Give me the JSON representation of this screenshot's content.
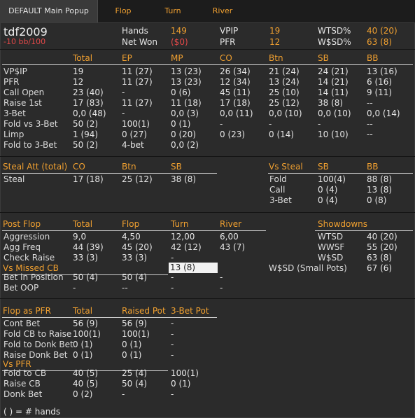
{
  "tabs": [
    "DEFAULT Main Popup",
    "Flop",
    "Turn",
    "River"
  ],
  "header": {
    "player": "tdf2009",
    "bb100": "-10 bb/100",
    "hands_label": "Hands",
    "hands": "149",
    "netwon_label": "Net Won",
    "netwon": "($0)",
    "vpip_label": "VPIP",
    "vpip": "19",
    "pfr_label": "PFR",
    "pfr": "12",
    "wtsd_label": "WTSD%",
    "wtsd": "40 (20)",
    "wsd_label": "W$SD%",
    "wsd": "63 (8)"
  },
  "preflop": {
    "columns": [
      "Total",
      "EP",
      "MP",
      "CO",
      "Btn",
      "SB",
      "BB"
    ],
    "rows": [
      {
        "label": "VP$IP",
        "cells": [
          "19",
          "11 (27)",
          "13 (23)",
          "26 (34)",
          "21 (24)",
          "24 (21)",
          "13 (16)"
        ]
      },
      {
        "label": "PFR",
        "cells": [
          "12",
          "11 (27)",
          "13 (23)",
          "12 (34)",
          "13 (24)",
          "14 (21)",
          "6 (16)"
        ]
      },
      {
        "label": "Call Open",
        "cells": [
          "23 (40)",
          "-",
          "0 (6)",
          "45 (11)",
          "25 (10)",
          "14 (11)",
          "9 (11)"
        ]
      },
      {
        "label": "Raise 1st",
        "cells": [
          "17 (83)",
          "11 (27)",
          "11 (18)",
          "17 (18)",
          "25 (12)",
          "38 (8)",
          "--"
        ]
      },
      {
        "label": "3-Bet",
        "cells": [
          "0,0 (48)",
          "-",
          "0,0 (3)",
          "0,0 (11)",
          "0,0 (10)",
          "0,0 (10)",
          "0,0 (14)"
        ]
      },
      {
        "label": "Fold vs 3-Bet",
        "cells": [
          "50 (2)",
          "100(1)",
          "0 (1)",
          "-",
          "-",
          "-",
          "--"
        ]
      },
      {
        "label": "Limp",
        "cells": [
          "1 (94)",
          "0 (27)",
          "0 (20)",
          "0 (23)",
          "0 (14)",
          "10 (10)",
          "--"
        ]
      },
      {
        "label": "Fold to 3-Bet",
        "cells": [
          "50 (2)",
          "4-bet",
          "0,0 (2)",
          "",
          "",
          "",
          ""
        ]
      }
    ]
  },
  "steal": {
    "title": "Steal Att (total)",
    "columns": [
      "CO",
      "Btn",
      "SB"
    ],
    "row": {
      "label": "Steal",
      "cells": [
        "17 (18)",
        "25 (12)",
        "38 (8)"
      ]
    },
    "vs_title": "Vs Steal",
    "vs_columns": [
      "SB",
      "BB"
    ],
    "vs_rows": [
      {
        "label": "Fold",
        "cells": [
          "100(4)",
          "88 (8)"
        ]
      },
      {
        "label": "Call",
        "cells": [
          "0 (4)",
          "13 (8)"
        ]
      },
      {
        "label": "3-Bet",
        "cells": [
          "0 (4)",
          "0 (8)"
        ]
      }
    ]
  },
  "postflop": {
    "title": "Post Flop",
    "columns": [
      "Total",
      "Flop",
      "Turn",
      "River"
    ],
    "rows": [
      {
        "label": "Aggression",
        "cells": [
          "9,0",
          "4,50",
          "12,00",
          "6,00"
        ]
      },
      {
        "label": "Agg Freq",
        "cells": [
          "44 (39)",
          "45 (20)",
          "42 (12)",
          "43 (7)"
        ]
      },
      {
        "label": "Check Raise",
        "cells": [
          "33 (3)",
          "33 (3)",
          "-",
          ""
        ]
      }
    ],
    "missed_cb_title": "Vs Missed CB",
    "missed_cb_value": "13 (8)",
    "rows2": [
      {
        "label": "Bet in Position",
        "cells": [
          "50 (4)",
          "50 (4)",
          "-",
          "-"
        ]
      },
      {
        "label": "Bet OOP",
        "cells": [
          "-",
          "--",
          "-",
          "-"
        ]
      }
    ],
    "showdowns_title": "Showdowns",
    "showdowns": [
      {
        "label": "WTSD",
        "value": "40 (20)"
      },
      {
        "label": "WWSF",
        "value": "55 (20)"
      },
      {
        "label": "W$SD",
        "value": "63 (8)"
      },
      {
        "label": "W$SD (Small Pots)",
        "value": "67 (6)"
      }
    ]
  },
  "flop_pfr": {
    "title": "Flop as PFR",
    "columns": [
      "Total",
      "Raised Pot",
      "3-Bet Pot"
    ],
    "rows": [
      {
        "label": "Cont Bet",
        "cells": [
          "56 (9)",
          "56 (9)",
          "-"
        ]
      },
      {
        "label": "Fold CB to Raise",
        "cells": [
          "100(1)",
          "100(1)",
          "-"
        ]
      },
      {
        "label": "Fold to Donk Bet",
        "cells": [
          "0 (1)",
          "0 (1)",
          "-"
        ]
      },
      {
        "label": "Raise Donk Bet",
        "cells": [
          "0 (1)",
          "0 (1)",
          "-"
        ]
      }
    ],
    "vs_pfr_title": "Vs PFR",
    "vs_rows": [
      {
        "label": "Fold to CB",
        "cells": [
          "40 (5)",
          "25 (4)",
          "100(1)"
        ]
      },
      {
        "label": "Raise CB",
        "cells": [
          "40 (5)",
          "50 (4)",
          "0 (1)"
        ]
      },
      {
        "label": "Donk Bet",
        "cells": [
          "0 (2)",
          "-",
          "-"
        ]
      }
    ]
  },
  "footer": "( ) = # hands"
}
